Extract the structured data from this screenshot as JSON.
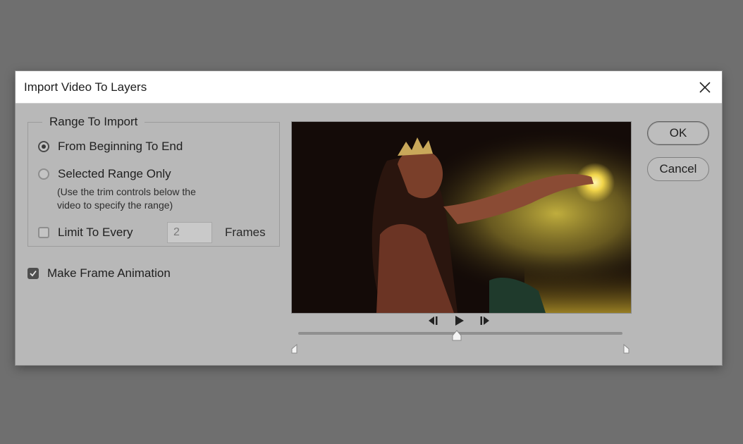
{
  "dialog": {
    "title": "Import Video To Layers"
  },
  "range": {
    "legend": "Range To Import",
    "option_full": "From Beginning To End",
    "option_selected": "Selected Range Only",
    "hint_line1": "(Use the trim controls below the",
    "hint_line2": "video to specify the range)",
    "selected_option": "From Beginning To End",
    "limit_label": "Limit To Every",
    "limit_checked": false,
    "frames_value": "2",
    "frames_label": "Frames"
  },
  "animation": {
    "label": "Make Frame Animation",
    "checked": true
  },
  "playback": {
    "position_fraction": 0.49,
    "icons": [
      "step-back-icon",
      "play-icon",
      "step-forward-icon"
    ]
  },
  "buttons": {
    "ok": "OK",
    "cancel": "Cancel"
  },
  "colors": {
    "dialog_bg": "#b8b8b8",
    "backdrop": "#6f6f6f",
    "titlebar": "#ffffff"
  }
}
